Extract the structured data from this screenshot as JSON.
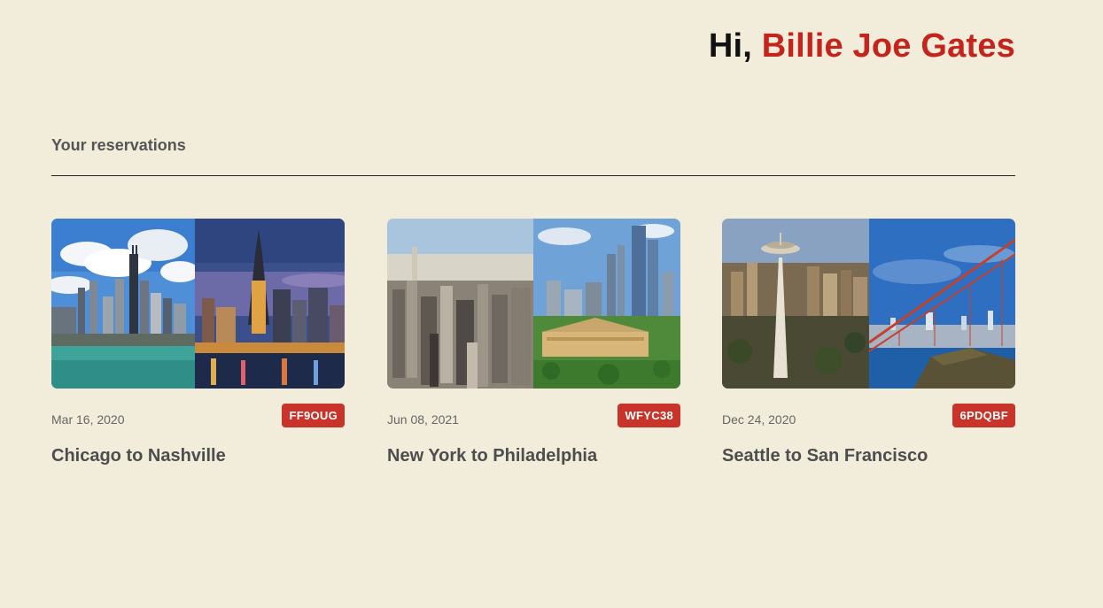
{
  "header": {
    "greeting_prefix": "Hi, ",
    "user_name": "Billie Joe Gates"
  },
  "section": {
    "title": "Your reservations"
  },
  "reservations": [
    {
      "date": "Mar 16, 2020",
      "code": "FF9OUG",
      "route": "Chicago to Nashville",
      "images": [
        "chicago-skyline-photo",
        "nashville-skyline-photo"
      ]
    },
    {
      "date": "Jun 08, 2021",
      "code": "WFYC38",
      "route": "New York to Philadelphia",
      "images": [
        "new-york-skyline-photo",
        "philadelphia-skyline-photo"
      ]
    },
    {
      "date": "Dec 24, 2020",
      "code": "6PDQBF",
      "route": "Seattle to San Francisco",
      "images": [
        "seattle-space-needle-photo",
        "san-francisco-golden-gate-photo"
      ]
    }
  ],
  "colors": {
    "background": "#f2ecdb",
    "accent": "#c4241b",
    "badge": "#c8342a",
    "text": "#4d4d4d"
  }
}
